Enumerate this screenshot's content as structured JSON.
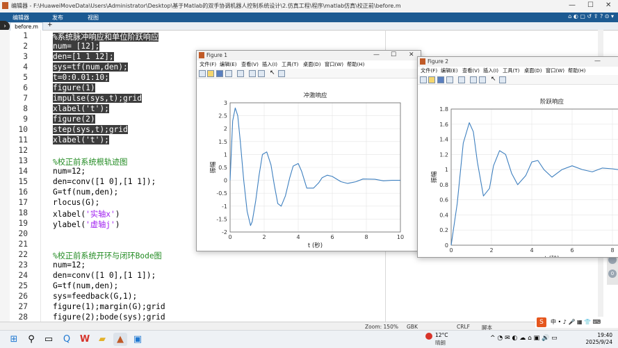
{
  "window": {
    "title": "编辑器 - F:\\HuaweiMoveData\\Users\\Administrator\\Desktop\\基于Matlab的双手协调机器人控制系统设计\\2.仿真工程\\程序\\matlab仿真\\校正前\\before.m",
    "minimize": "—",
    "maximize": "☐",
    "close": "✕"
  },
  "toolstrip": {
    "tabs": [
      "编辑器",
      "发布",
      "视图"
    ],
    "right_icons": "⌂ ◐ ▢ ↺ ⇪ ? ⊙ ▾"
  },
  "doc_tabs": {
    "active": "before.m",
    "add": "+",
    "expand": "›"
  },
  "editor": {
    "lines": [
      {
        "n": "1",
        "t": "%系统脉冲响应和单位阶跃响应"
      },
      {
        "n": "2",
        "t": "num= [12];"
      },
      {
        "n": "3",
        "t": "den=[1 1 12];"
      },
      {
        "n": "4",
        "t": "sys=tf(num,den);"
      },
      {
        "n": "5",
        "t": "t=0:0.01:10;"
      },
      {
        "n": "6",
        "t": "figure(1)"
      },
      {
        "n": "7",
        "t": "impulse(sys,t);grid"
      },
      {
        "n": "8",
        "t": "xlabel('t');"
      },
      {
        "n": "9",
        "t": "figure(2)"
      },
      {
        "n": "10",
        "t": "step(sys,t);grid"
      },
      {
        "n": "11",
        "t": "xlabel('t');"
      },
      {
        "n": "12",
        "t": ""
      },
      {
        "n": "13",
        "t": "%校正前系统根轨迹图"
      },
      {
        "n": "14",
        "t": "num=12;"
      },
      {
        "n": "15",
        "t": "den=conv([1 0],[1 1]);"
      },
      {
        "n": "16",
        "t": "G=tf(num,den);"
      },
      {
        "n": "17",
        "t": "rlocus(G);"
      },
      {
        "n": "18a",
        "t": "xlabel("
      },
      {
        "n": "18b",
        "t": "'实轴x'"
      },
      {
        "n": "18c",
        "t": ")"
      },
      {
        "n": "19a",
        "t": "ylabel("
      },
      {
        "n": "19b",
        "t": "'虚轴j'"
      },
      {
        "n": "19c",
        "t": ")"
      },
      {
        "n": "20",
        "t": ""
      },
      {
        "n": "21",
        "t": ""
      },
      {
        "n": "22",
        "t": "%校正前系统开环与闭环Bode图"
      },
      {
        "n": "23",
        "t": "num=12;"
      },
      {
        "n": "24",
        "t": "den=conv([1 0],[1 1]);"
      },
      {
        "n": "25",
        "t": "G=tf(num,den);"
      },
      {
        "n": "26",
        "t": "sys=feedback(G,1);"
      },
      {
        "n": "27",
        "t": "figure(1);margin(G);grid"
      },
      {
        "n": "28",
        "t": "figure(2);bode(sys);grid"
      }
    ],
    "line_numbers": [
      "1",
      "2",
      "3",
      "4",
      "5",
      "6",
      "7",
      "8",
      "9",
      "10",
      "11",
      "12",
      "13",
      "14",
      "15",
      "16",
      "17",
      "18",
      "19",
      "20",
      "21",
      "22",
      "23",
      "24",
      "25",
      "26",
      "27",
      "28"
    ]
  },
  "statusbar": {
    "zoom": "Zoom: 150%",
    "encoding": "GBK",
    "eol": "CRLF",
    "mode": "脚本"
  },
  "figure1": {
    "title": "Figure 1",
    "menu": [
      "文件(F)",
      "编辑(E)",
      "查看(V)",
      "插入(I)",
      "工具(T)",
      "桌面(D)",
      "窗口(W)",
      "帮助(H)"
    ],
    "win": {
      "min": "—",
      "max": "☐",
      "close": "✕"
    }
  },
  "figure2": {
    "title": "Figure 2",
    "menu": [
      "文件(F)",
      "编辑(E)",
      "查看(V)",
      "插入(I)",
      "工具(T)",
      "桌面(D)",
      "窗口(W)",
      "帮助(H)"
    ],
    "win": {
      "min": "—"
    }
  },
  "chart_data": [
    {
      "type": "line",
      "title": "冲激响应",
      "xlabel": "t (秒)",
      "ylabel": "振幅",
      "xlim": [
        0,
        10
      ],
      "ylim": [
        -2,
        3
      ],
      "grid": true,
      "xticks": [
        "0",
        "2",
        "4",
        "6",
        "8",
        "10"
      ],
      "yticks": [
        "3",
        "2.5",
        "2",
        "1.5",
        "1",
        "0.5",
        "0",
        "-0.5",
        "-1",
        "-1.5",
        "-2"
      ],
      "series": [
        {
          "x": [
            0,
            0.15,
            0.3,
            0.45,
            0.6,
            0.8,
            1.0,
            1.2,
            1.3,
            1.5,
            1.7,
            1.9,
            2.15,
            2.4,
            2.6,
            2.8,
            3.0,
            3.25,
            3.5,
            3.7,
            4.0,
            4.2,
            4.5,
            4.9,
            5.2,
            5.4,
            5.7,
            6.0,
            6.5,
            6.9,
            7.4,
            7.8,
            8.5,
            9.0,
            9.5,
            10.0
          ],
          "y": [
            0,
            2.3,
            2.8,
            2.5,
            1.5,
            0,
            -1.2,
            -1.75,
            -1.6,
            -0.8,
            0.2,
            1.0,
            1.1,
            0.6,
            -0.2,
            -0.9,
            -1.0,
            -0.6,
            0.1,
            0.55,
            0.65,
            0.35,
            -0.3,
            -0.3,
            -0.1,
            0.1,
            0.2,
            0.15,
            -0.05,
            -0.12,
            -0.05,
            0.05,
            0.04,
            -0.02,
            0.0,
            0.0
          ]
        }
      ]
    },
    {
      "type": "line",
      "title": "阶跃响应",
      "xlabel": "t (秒)",
      "ylabel": "振幅",
      "xlim": [
        0,
        10
      ],
      "ylim": [
        0,
        1.8
      ],
      "grid": true,
      "xticks": [
        "0",
        "2",
        "4",
        "6",
        "8"
      ],
      "yticks": [
        "1.8",
        "1.6",
        "1.4",
        "1.2",
        "1",
        "0.8",
        "0.6",
        "0.4",
        "0.2",
        "0"
      ],
      "series": [
        {
          "x": [
            0,
            0.3,
            0.6,
            0.9,
            1.1,
            1.3,
            1.6,
            1.9,
            2.1,
            2.4,
            2.7,
            3.0,
            3.3,
            3.7,
            4.0,
            4.3,
            4.6,
            5.0,
            5.5,
            6.0,
            6.5,
            7.0,
            7.5,
            8.0,
            8.5,
            9.0,
            9.5,
            10.0
          ],
          "y": [
            0,
            0.55,
            1.35,
            1.62,
            1.5,
            1.1,
            0.65,
            0.75,
            1.05,
            1.25,
            1.2,
            0.95,
            0.8,
            0.92,
            1.1,
            1.12,
            1.0,
            0.9,
            1.0,
            1.05,
            1.0,
            0.97,
            1.02,
            1.01,
            0.99,
            1.0,
            1.0,
            1.0
          ]
        }
      ]
    }
  ],
  "right_panel": {
    "labels": [
      "1",
      "4",
      "0"
    ]
  },
  "float_bar": {
    "text": "中 • ♪ 🎤 ▦ 👕 ⌨"
  },
  "taskbar": {
    "weather_temp": "12°C",
    "weather_desc": "晴朗",
    "time": "19:40",
    "date": "2025/9/24",
    "tray": "^ ◔ ✉ ◐ ☁ ⌂ ▣ 🔊 ▭"
  }
}
